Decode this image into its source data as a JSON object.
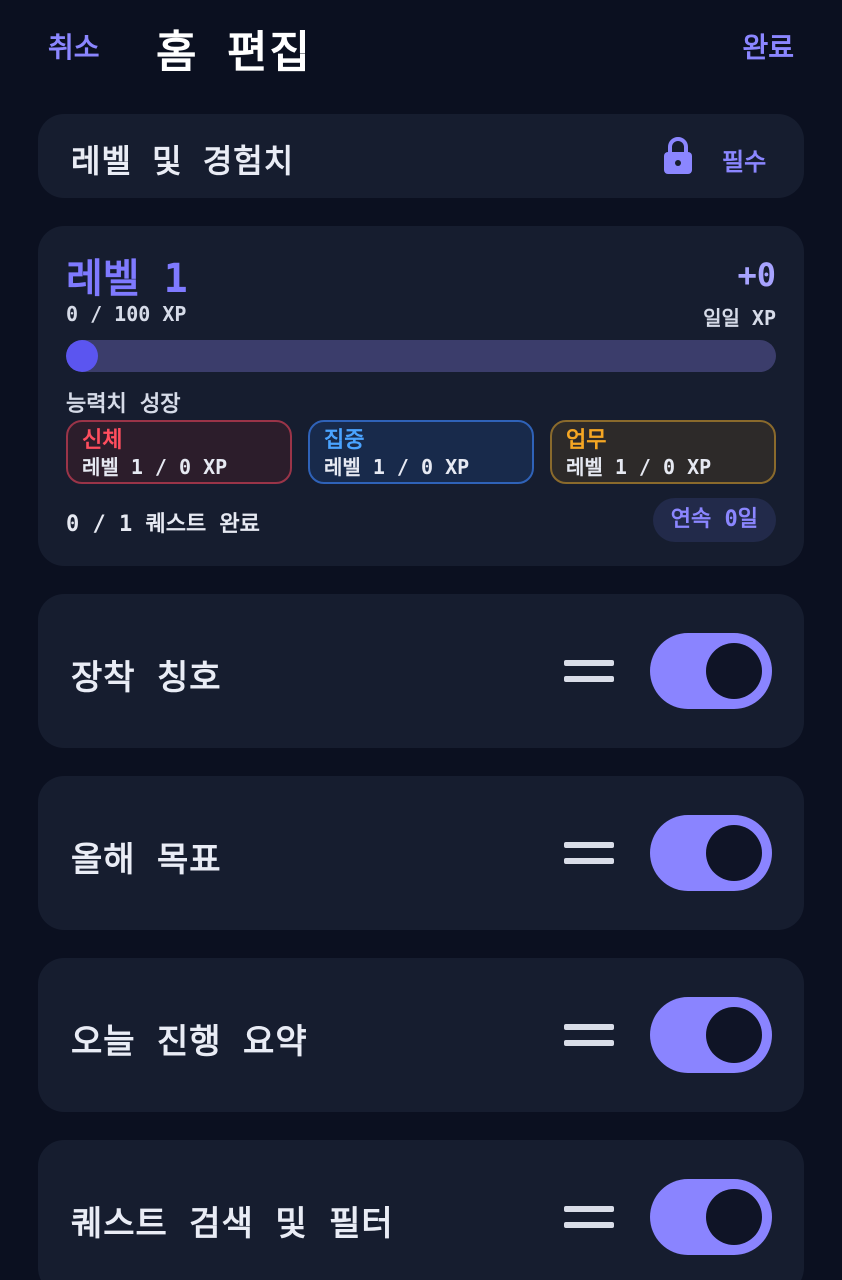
{
  "header": {
    "cancel_label": "취소",
    "title": "홈 편집",
    "done_label": "완료"
  },
  "required_section": {
    "label": "레벨 및 경험치",
    "icon": "lock-icon",
    "tag": "필수"
  },
  "level_card": {
    "title": "레벨 1",
    "daily_gain": "+0",
    "xp_text": "0 / 100 XP",
    "daily_label": "일일 XP",
    "progress": 0.0,
    "stats_label": "능력치 성장",
    "stats": [
      {
        "name": "신체",
        "value": "레벨 1 / 0 XP",
        "color": "#ff4d5e"
      },
      {
        "name": "집중",
        "value": "레벨 1 / 0 XP",
        "color": "#4aa3ff"
      },
      {
        "name": "업무",
        "value": "레벨 1 / 0 XP",
        "color": "#f5a623"
      }
    ],
    "quests_text": "0 / 1 퀘스트 완료",
    "streak_text": "연속 0일"
  },
  "sections": [
    {
      "label": "장착 칭호",
      "enabled": true
    },
    {
      "label": "올해 목표",
      "enabled": true
    },
    {
      "label": "오늘 진행 요약",
      "enabled": true
    },
    {
      "label": "퀘스트 검색 및 필터",
      "enabled": true
    }
  ],
  "colors": {
    "accent": "#8b86ff",
    "background": "#0b1020",
    "card": "#161d2f"
  }
}
